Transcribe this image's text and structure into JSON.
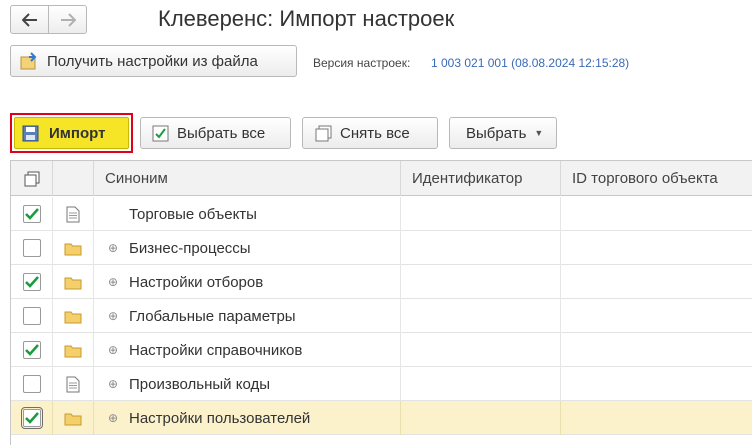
{
  "header": {
    "title": "Клеверенс: Импорт настроек",
    "nav_back_icon": "arrow-left-icon",
    "nav_forward_icon": "arrow-right-icon"
  },
  "toolbar_top": {
    "load_button_label": "Получить настройки из файла",
    "version_label": "Версия настроек:",
    "version_value": "1 003 021 001 (08.08.2024 12:15:28)"
  },
  "toolbar": {
    "import_label": "Импорт",
    "select_all_label": "Выбрать все",
    "unselect_all_label": "Снять все",
    "select_label": "Выбрать"
  },
  "table": {
    "columns": {
      "synonym": "Синоним",
      "identifier": "Идентификатор",
      "trade_object_id": "ID торгового объекта"
    },
    "rows": [
      {
        "checked": true,
        "icon": "document-icon",
        "expandable": false,
        "name": "Торговые объекты"
      },
      {
        "checked": false,
        "icon": "folder-icon",
        "expandable": true,
        "name": "Бизнес-процессы"
      },
      {
        "checked": true,
        "icon": "folder-icon",
        "expandable": true,
        "name": "Настройки отборов"
      },
      {
        "checked": false,
        "icon": "folder-icon",
        "expandable": true,
        "name": "Глобальные параметры"
      },
      {
        "checked": true,
        "icon": "folder-icon",
        "expandable": true,
        "name": "Настройки справочников"
      },
      {
        "checked": false,
        "icon": "document-icon",
        "expandable": true,
        "name": "Произвольный коды"
      },
      {
        "checked": true,
        "icon": "folder-icon",
        "expandable": true,
        "name": "Настройки пользователей",
        "selected": true
      }
    ]
  },
  "colors": {
    "accent_yellow": "#f6e426",
    "highlight_red": "#e0001b",
    "check_green": "#1a9c3e",
    "link_blue": "#3b6ab5",
    "selected_row": "#fbf2cc"
  }
}
